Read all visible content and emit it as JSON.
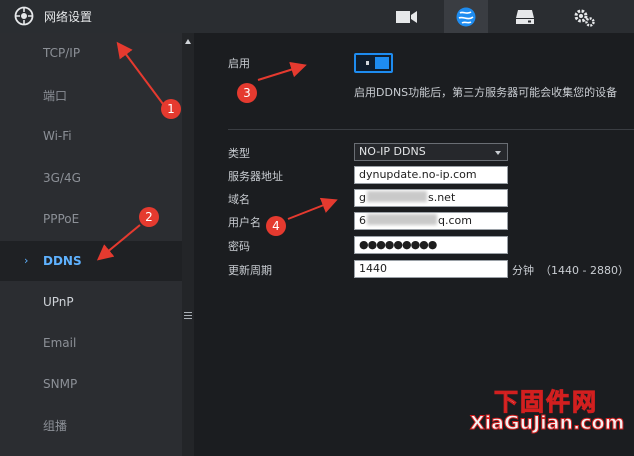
{
  "header": {
    "title": "网络设置",
    "nav": [
      {
        "icon": "video-camera-icon"
      },
      {
        "icon": "network-globe-icon",
        "active": true
      },
      {
        "icon": "storage-drive-icon"
      },
      {
        "icon": "gears-icon"
      }
    ]
  },
  "sidebar": {
    "items": [
      {
        "label": "TCP/IP"
      },
      {
        "label": "端口"
      },
      {
        "label": "Wi-Fi"
      },
      {
        "label": "3G/4G"
      },
      {
        "label": "PPPoE"
      },
      {
        "label": "DDNS",
        "active": true
      },
      {
        "label": "UPnP"
      },
      {
        "label": "Email"
      },
      {
        "label": "SNMP"
      },
      {
        "label": "组播"
      }
    ]
  },
  "ddns": {
    "enable_label": "启用",
    "enabled": true,
    "notice": "启用DDNS功能后，第三方服务器可能会收集您的设备",
    "type_label": "类型",
    "type_value": "NO-IP DDNS",
    "server_label": "服务器地址",
    "server_value": "dynupdate.no-ip.com",
    "domain_label": "域名",
    "domain_prefix": "g",
    "domain_suffix": "s.net",
    "username_label": "用户名",
    "username_prefix": "6",
    "username_suffix": "q.com",
    "password_label": "密码",
    "password_value": "●●●●●●●●●",
    "period_label": "更新周期",
    "period_value": "1440",
    "period_unit": "分钟",
    "period_range": "（1440 - 2880）"
  },
  "annotations": {
    "badges": [
      "1",
      "2",
      "3",
      "4"
    ],
    "color": "#e53a2f"
  },
  "watermark": {
    "line1": "下固件网",
    "line2": "XiaGuJian.com"
  },
  "colors": {
    "accent": "#1e8cf0",
    "active_text": "#5fb2ff",
    "annotation_red": "#e53a2f"
  }
}
